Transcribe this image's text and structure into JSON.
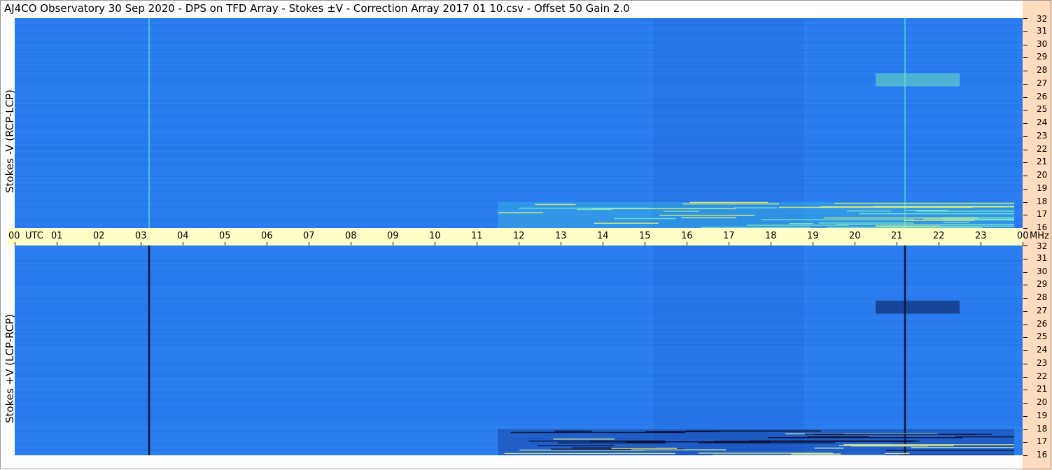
{
  "title": "AJ4CO Observatory  30 Sep 2020  -  DPS on TFD Array  -  Stokes ±V  -  Correction Array 2017 01 10.csv  -  Offset 50  Gain 2.0",
  "colors": {
    "background": "#2a7cf0",
    "utc_bar": "#ffffc8",
    "freq_bar": "#ffdcbe"
  },
  "chart_data": [
    {
      "type": "heatmap",
      "ylabel": "Stokes -V (RCP-LCP)",
      "x_ticks": [
        "00",
        "01",
        "02",
        "03",
        "04",
        "05",
        "06",
        "07",
        "08",
        "09",
        "10",
        "11",
        "12",
        "13",
        "14",
        "15",
        "16",
        "17",
        "18",
        "19",
        "20",
        "21",
        "22",
        "23",
        "00"
      ],
      "x_unit": "UTC",
      "y_ticks": [
        "32",
        "31",
        "30",
        "29",
        "28",
        "27",
        "26",
        "25",
        "24",
        "23",
        "22",
        "21",
        "20",
        "19",
        "18",
        "17",
        "16"
      ],
      "y_unit": "MHz",
      "ylim": [
        16,
        32
      ],
      "features": [
        {
          "kind": "vertical_line",
          "time_utc": 3.2,
          "tone": "bright"
        },
        {
          "kind": "vertical_line",
          "time_utc": 21.2,
          "tone": "bright"
        },
        {
          "kind": "burst_streaks",
          "time_utc": [
            11.5,
            23.8
          ],
          "freq_mhz": [
            16,
            18
          ],
          "tone": "bright"
        },
        {
          "kind": "band_enhancement",
          "time_utc": [
            20.5,
            22.5
          ],
          "freq_mhz": [
            26.8,
            27.8
          ],
          "tone": "bright"
        }
      ]
    },
    {
      "type": "heatmap",
      "ylabel": "Stokes +V (LCP-RCP)",
      "x_ticks": [
        "00",
        "01",
        "02",
        "03",
        "04",
        "05",
        "06",
        "07",
        "08",
        "09",
        "10",
        "11",
        "12",
        "13",
        "14",
        "15",
        "16",
        "17",
        "18",
        "19",
        "20",
        "21",
        "22",
        "23",
        "00"
      ],
      "x_unit": "UTC",
      "y_ticks": [
        "32",
        "31",
        "30",
        "29",
        "28",
        "27",
        "26",
        "25",
        "24",
        "23",
        "22",
        "21",
        "20",
        "19",
        "18",
        "17",
        "16"
      ],
      "y_unit": "MHz",
      "ylim": [
        16,
        32
      ],
      "features": [
        {
          "kind": "vertical_line",
          "time_utc": 3.2,
          "tone": "dark"
        },
        {
          "kind": "vertical_line",
          "time_utc": 21.2,
          "tone": "dark"
        },
        {
          "kind": "burst_streaks",
          "time_utc": [
            11.5,
            23.8
          ],
          "freq_mhz": [
            16,
            18
          ],
          "tone": "dark"
        },
        {
          "kind": "band_enhancement",
          "time_utc": [
            20.5,
            22.5
          ],
          "freq_mhz": [
            26.8,
            27.8
          ],
          "tone": "dark"
        }
      ]
    }
  ]
}
